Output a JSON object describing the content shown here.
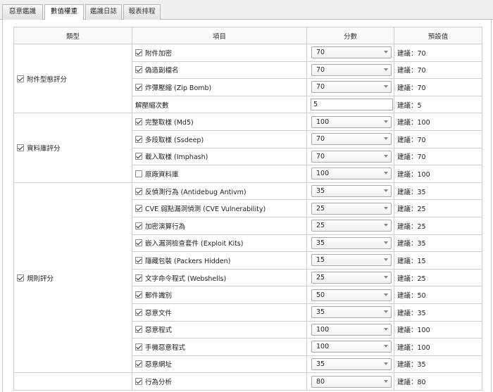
{
  "tabs": [
    "惡意鑑識",
    "數值權重",
    "鑑識日誌",
    "報表排程"
  ],
  "headers": {
    "type": "類型",
    "item": "項目",
    "score": "分數",
    "default": "預設值"
  },
  "categories": [
    {
      "label": "附件型態評分",
      "checked": true
    },
    {
      "label": "資料庫評分",
      "checked": true
    },
    {
      "label": "規則評分",
      "checked": true
    }
  ],
  "rows": [
    {
      "label": "附件加密",
      "checked": true,
      "value": "70",
      "default": "建議：70"
    },
    {
      "label": "偽造副檔名",
      "checked": true,
      "value": "70",
      "default": "建議：70"
    },
    {
      "label": "炸彈壓縮 (Zip Bomb)",
      "checked": true,
      "value": "70",
      "default": "建議：70"
    },
    {
      "label": "解壓縮次數",
      "input": true,
      "value": "5",
      "default": "建議：5"
    },
    {
      "label": "完整取樣 (Md5)",
      "checked": true,
      "value": "100",
      "default": "建議：100"
    },
    {
      "label": "多段取樣 (Ssdeep)",
      "checked": true,
      "value": "70",
      "default": "建議：70"
    },
    {
      "label": "載入取樣 (Imphash)",
      "checked": true,
      "value": "70",
      "default": "建議：70"
    },
    {
      "label": "原廠資料庫",
      "checked": false,
      "value": "100",
      "default": "建議：100"
    },
    {
      "label": "反偵測行為 (Antidebug Antivm)",
      "checked": true,
      "value": "35",
      "default": "建議：35"
    },
    {
      "label": "CVE 弱點漏洞偵測 (CVE Vulnerability)",
      "checked": true,
      "value": "25",
      "default": "建議：25"
    },
    {
      "label": "加密演算行為",
      "checked": true,
      "value": "25",
      "default": "建議：25"
    },
    {
      "label": "嵌入漏洞檢查套件 (Exploit Kits)",
      "checked": true,
      "value": "35",
      "default": "建議：35"
    },
    {
      "label": "隱藏包裝 (Packers Hidden)",
      "checked": true,
      "value": "15",
      "default": "建議：15"
    },
    {
      "label": "文字命令程式 (Webshells)",
      "checked": true,
      "value": "25",
      "default": "建議：25"
    },
    {
      "label": "郵件識別",
      "checked": true,
      "value": "50",
      "default": "建議：50"
    },
    {
      "label": "惡意文件",
      "checked": true,
      "value": "35",
      "default": "建議：35"
    },
    {
      "label": "惡意程式",
      "checked": true,
      "value": "100",
      "default": "建議：100"
    },
    {
      "label": "手機惡意程式",
      "checked": true,
      "value": "100",
      "default": "建議：100"
    },
    {
      "label": "惡意網址",
      "checked": true,
      "value": "35",
      "default": "建議：35"
    },
    {
      "label": "行為分析",
      "checked": true,
      "value": "80",
      "default": "建議：80"
    }
  ],
  "colors": {
    "border": "#cfcfcf",
    "tab_bg": "#e3e3e3",
    "panel_bg": "#ffffff"
  }
}
